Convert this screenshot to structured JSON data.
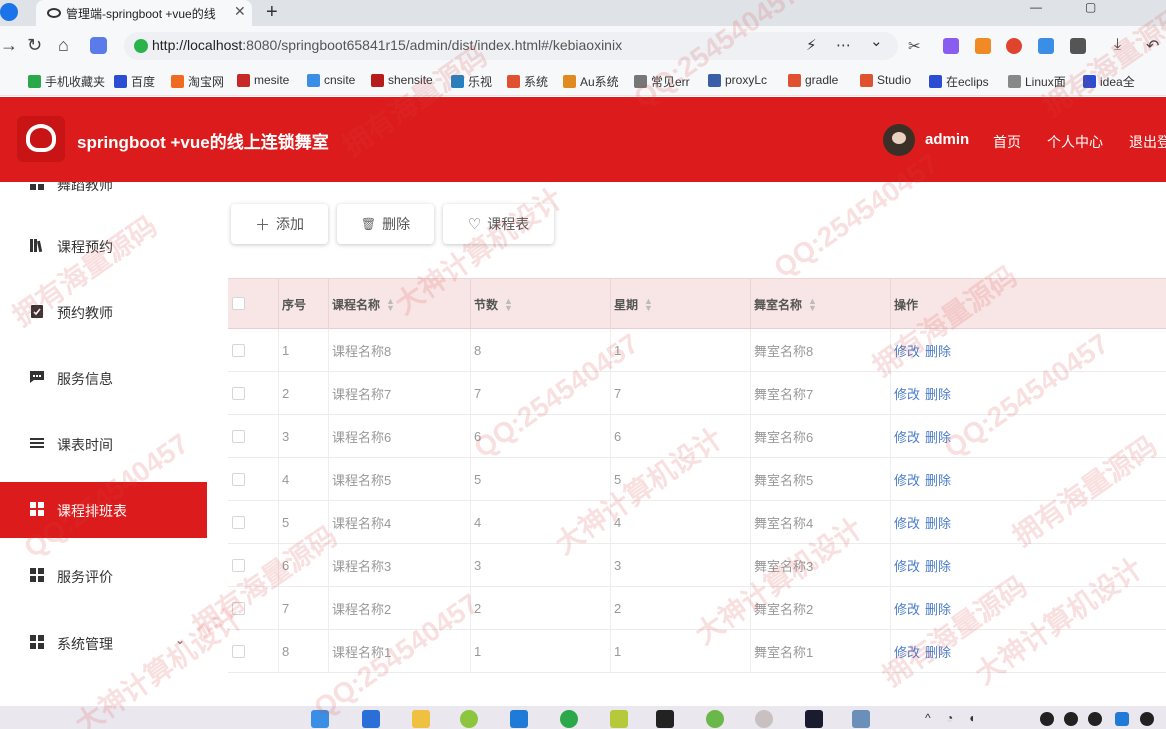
{
  "browser": {
    "tab_title": "管理端-springboot +vue的线",
    "tab_close": "✕",
    "new_tab": "+",
    "window_controls": [
      "—",
      "▢"
    ],
    "url_host": "http://localhost",
    "url_rest": ":8080/springboot65841r15/admin/dist/index.html#/kebiaoxinix",
    "url_actions": [
      "⚡",
      "⋯",
      "⌄"
    ],
    "bookmarks": [
      {
        "label": "手机收藏夹",
        "color": "#2aa84a"
      },
      {
        "label": "百度",
        "color": "#2a4dd1"
      },
      {
        "label": "淘宝网",
        "color": "#f06b1f"
      },
      {
        "label": "mesite",
        "color": "#c62828"
      },
      {
        "label": "cnsite",
        "color": "#3a8ee6"
      },
      {
        "label": "shensite",
        "color": "#b71c1c"
      },
      {
        "label": "乐视",
        "color": "#1c84c6"
      },
      {
        "label": "系统",
        "color": "#e0512f"
      },
      {
        "label": "Au系统",
        "color": "#e08a1f"
      },
      {
        "label": "常见err",
        "color": "#777777"
      },
      {
        "label": "proxyLc",
        "color": "#3a5fa8"
      },
      {
        "label": "gradle",
        "color": "#e0512f"
      },
      {
        "label": "Studio",
        "color": "#e0512f"
      },
      {
        "label": "在eclips",
        "color": "#2a4dd1"
      },
      {
        "label": "Linux面",
        "color": "#888888"
      },
      {
        "label": "idea全",
        "color": "#2a4dd1"
      }
    ]
  },
  "header": {
    "title": "springboot +vue的线上连锁舞室",
    "username": "admin",
    "nav": [
      "首页",
      "个人中心",
      "退出登"
    ]
  },
  "sidebar": {
    "items": [
      {
        "label": "舞蹈教师",
        "icon": "grid-icon"
      },
      {
        "label": "课程预约",
        "icon": "bookshelf-icon"
      },
      {
        "label": "预约教师",
        "icon": "clipboard-check-icon"
      },
      {
        "label": "服务信息",
        "icon": "chat-icon"
      },
      {
        "label": "课表时间",
        "icon": "list-icon"
      },
      {
        "label": "课程排班表",
        "icon": "grid-icon",
        "active": true
      },
      {
        "label": "服务评价",
        "icon": "grid-icon"
      },
      {
        "label": "系统管理",
        "icon": "grid-icon",
        "expandable": true
      }
    ],
    "arrow": "⌄"
  },
  "toolbar": {
    "add": {
      "label": "添加",
      "icon": "＋"
    },
    "delete": {
      "label": "删除",
      "icon": "🗑"
    },
    "schedule": {
      "label": "课程表",
      "icon": "♡"
    }
  },
  "table": {
    "columns": [
      "序号",
      "课程名称",
      "节数",
      "星期",
      "舞室名称",
      "操作"
    ],
    "sortable": [
      false,
      true,
      true,
      true,
      true,
      false
    ],
    "rows": [
      [
        "1",
        "课程名称8",
        "8",
        "1",
        "舞室名称8"
      ],
      [
        "2",
        "课程名称7",
        "7",
        "7",
        "舞室名称7"
      ],
      [
        "3",
        "课程名称6",
        "6",
        "6",
        "舞室名称6"
      ],
      [
        "4",
        "课程名称5",
        "5",
        "5",
        "舞室名称5"
      ],
      [
        "5",
        "课程名称4",
        "4",
        "4",
        "舞室名称4"
      ],
      [
        "6",
        "课程名称3",
        "3",
        "3",
        "舞室名称3"
      ],
      [
        "7",
        "课程名称2",
        "2",
        "2",
        "舞室名称2"
      ],
      [
        "8",
        "课程名称1",
        "1",
        "1",
        "舞室名称1"
      ]
    ],
    "actions": [
      "修改",
      "删除"
    ]
  },
  "watermark": [
    "拥有海量源码",
    "QQ:254540457",
    "大神计算机设计"
  ],
  "colors": {
    "primary": "#dc1c1c",
    "header_row": "#f8e6e6",
    "link": "#4a7ccd"
  }
}
